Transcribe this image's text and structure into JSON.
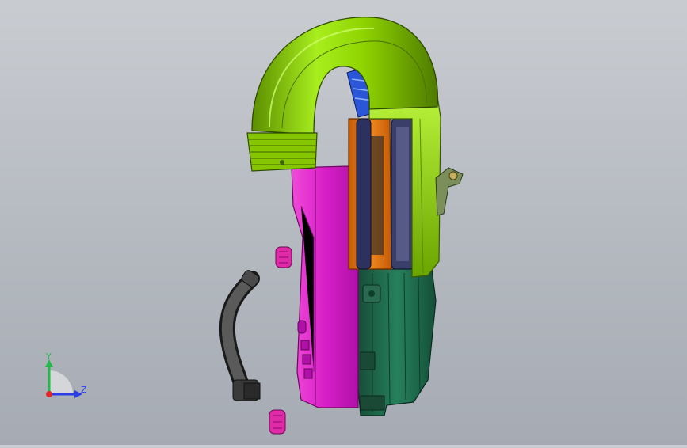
{
  "viewport": {
    "background_top": "#c9ccd1",
    "background_bottom": "#a6abb3",
    "parts": [
      {
        "name": "intake-duct-elbow",
        "color": "#8fd400"
      },
      {
        "name": "filter-housing-cover",
        "color": "#9fe020"
      },
      {
        "name": "filter-frame",
        "color": "#ef7a10"
      },
      {
        "name": "filter-seal-gasket",
        "color": "#3a3f6a"
      },
      {
        "name": "lower-housing",
        "color": "#1e6a4c"
      },
      {
        "name": "side-panel",
        "color": "#d81fc8"
      },
      {
        "name": "pink-grommet",
        "color": "#e02ba8"
      },
      {
        "name": "corrugated-hose",
        "color": "#3d3d3d"
      },
      {
        "name": "bracket-sensor",
        "color": "#7a8f5a"
      },
      {
        "name": "blue-inner-duct",
        "color": "#2a56d8"
      }
    ]
  },
  "triad": {
    "y_label": "Y",
    "z_label": "Z",
    "y_color": "#22b94a",
    "z_color": "#2a3fe8",
    "x_color": "#e02828"
  }
}
